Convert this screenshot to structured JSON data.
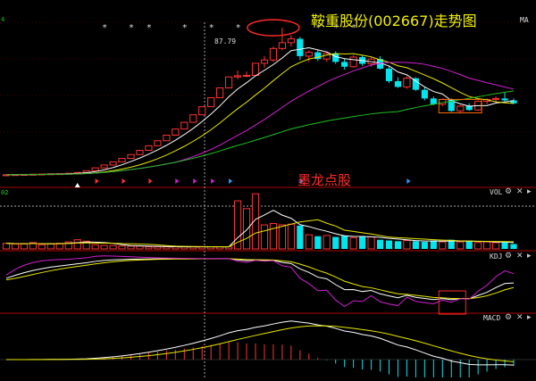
{
  "title": "鞍重股份(002667)走势图",
  "watermark": "墨龙点股",
  "main_panel": {
    "ma_label": "MA",
    "peak_label": "87.79"
  },
  "panels": [
    {
      "id": "vol",
      "label": "VOL"
    },
    {
      "id": "kdj",
      "label": "KDJ"
    },
    {
      "id": "macd",
      "label": "MACD"
    }
  ],
  "corner_marks": {
    "main": "4",
    "vol": "02"
  },
  "star_glyph": "*",
  "colors": {
    "background": "#000000",
    "up": "#ff3333",
    "down": "#00e5ee",
    "ma_white": "#ffffff",
    "ma_yellow": "#e8e800",
    "ma_magenta": "#d020d0",
    "ma_green": "#20c020",
    "title": "#f0f000",
    "annotation": "#ff2a2a",
    "grid": "#8a0000"
  },
  "chart_data": {
    "type": "candlestick",
    "candles": [
      [
        11.2,
        11.4,
        11.1,
        11.3
      ],
      [
        11.3,
        11.5,
        11.2,
        11.4
      ],
      [
        11.4,
        11.6,
        11.3,
        11.5
      ],
      [
        11.5,
        11.7,
        11.4,
        11.6
      ],
      [
        11.6,
        11.8,
        11.5,
        11.7
      ],
      [
        11.7,
        11.9,
        11.6,
        11.8
      ],
      [
        11.8,
        12.0,
        11.7,
        11.9
      ],
      [
        11.9,
        12.2,
        11.8,
        12.1
      ],
      [
        12.1,
        12.6,
        12.0,
        12.5
      ],
      [
        12.5,
        13.5,
        12.4,
        13.4
      ],
      [
        13.4,
        14.9,
        13.4,
        14.9
      ],
      [
        14.9,
        16.4,
        14.9,
        16.4
      ],
      [
        16.4,
        18.0,
        16.4,
        18.0
      ],
      [
        18.0,
        19.8,
        18.0,
        19.8
      ],
      [
        19.8,
        21.8,
        19.8,
        21.8
      ],
      [
        21.8,
        24.0,
        21.8,
        24.0
      ],
      [
        24.0,
        26.4,
        24.0,
        26.4
      ],
      [
        26.4,
        29.0,
        26.4,
        29.0
      ],
      [
        29.0,
        31.9,
        29.0,
        31.9
      ],
      [
        31.9,
        35.1,
        31.9,
        35.1
      ],
      [
        35.1,
        38.6,
        35.1,
        38.6
      ],
      [
        38.6,
        42.5,
        38.6,
        42.5
      ],
      [
        42.5,
        46.7,
        42.5,
        46.7
      ],
      [
        46.7,
        51.4,
        46.7,
        51.4
      ],
      [
        51.4,
        56.5,
        51.4,
        56.5
      ],
      [
        56.5,
        62.2,
        56.5,
        62.2
      ],
      [
        62.2,
        65.5,
        61.0,
        62.8
      ],
      [
        62.8,
        65.0,
        62.0,
        63.0
      ],
      [
        63.0,
        69.3,
        63.0,
        69.3
      ],
      [
        69.3,
        73.0,
        67.0,
        71.0
      ],
      [
        71.0,
        78.0,
        70.0,
        77.0
      ],
      [
        77.0,
        87.79,
        76.0,
        80.0
      ],
      [
        80.0,
        84.0,
        78.0,
        82.0
      ],
      [
        82.0,
        83.0,
        71.0,
        73.0
      ],
      [
        73.0,
        76.0,
        70.0,
        75.0
      ],
      [
        75.0,
        76.5,
        70.5,
        71.5
      ],
      [
        71.5,
        75.5,
        70.0,
        74.5
      ],
      [
        74.5,
        75.5,
        69.0,
        70.0
      ],
      [
        70.0,
        72.0,
        66.0,
        67.5
      ],
      [
        67.5,
        73.5,
        67.0,
        72.5
      ],
      [
        72.5,
        73.5,
        68.0,
        69.0
      ],
      [
        69.0,
        72.5,
        67.5,
        71.5
      ],
      [
        71.5,
        73.0,
        66.0,
        66.5
      ],
      [
        66.5,
        68.0,
        59.0,
        60.0
      ],
      [
        60.0,
        62.0,
        56.5,
        57.0
      ],
      [
        57.0,
        62.5,
        56.0,
        61.5
      ],
      [
        61.5,
        62.0,
        55.0,
        55.5
      ],
      [
        55.5,
        57.0,
        50.0,
        51.0
      ],
      [
        51.0,
        52.0,
        47.5,
        48.0
      ],
      [
        48.0,
        51.0,
        47.0,
        50.5
      ],
      [
        50.5,
        51.0,
        44.0,
        44.5
      ],
      [
        44.5,
        47.5,
        43.5,
        47.0
      ],
      [
        47.0,
        48.5,
        44.5,
        45.0
      ],
      [
        45.0,
        50.0,
        44.5,
        49.5
      ],
      [
        49.5,
        51.0,
        48.0,
        50.5
      ],
      [
        50.5,
        52.0,
        49.0,
        51.0
      ],
      [
        51.0,
        54.0,
        49.5,
        50.0
      ],
      [
        50.0,
        51.0,
        48.0,
        48.5
      ]
    ],
    "volume": [
      0.8,
      0.7,
      0.7,
      0.9,
      0.6,
      0.7,
      0.8,
      1.0,
      1.3,
      1.1,
      0.6,
      0.5,
      0.5,
      0.4,
      0.4,
      0.4,
      0.3,
      0.3,
      0.3,
      0.3,
      0.3,
      0.3,
      0.3,
      0.3,
      0.3,
      0.3,
      6.8,
      5.7,
      7.8,
      3.4,
      3.6,
      3.4,
      3.5,
      3.3,
      2.0,
      1.8,
      1.9,
      1.7,
      1.9,
      1.6,
      1.7,
      1.7,
      1.3,
      1.2,
      1.1,
      1.2,
      1.1,
      1.0,
      1.2,
      1.0,
      1.3,
      1.0,
      1.1,
      0.9,
      1.0,
      0.9,
      1.0,
      0.7
    ],
    "kdj_range": [
      -20,
      110
    ],
    "macd_range": [
      -3,
      8
    ],
    "main_range": [
      8,
      92
    ]
  }
}
